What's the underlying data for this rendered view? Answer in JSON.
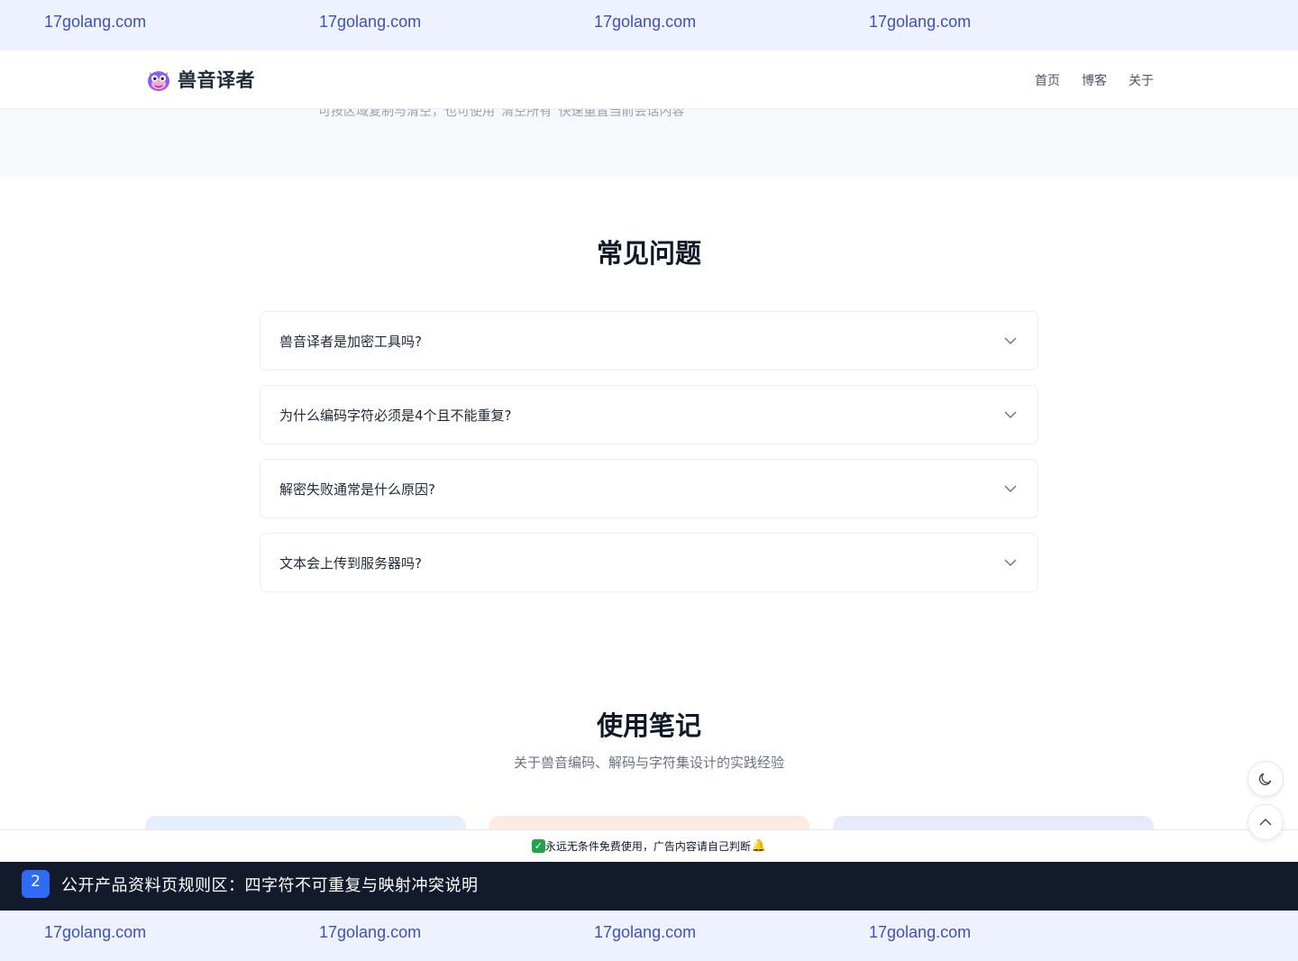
{
  "ad_banner": {
    "top_items": [
      "17golang.com",
      "17golang.com",
      "17golang.com",
      "17golang.com"
    ],
    "bottom_items": [
      "17golang.com",
      "17golang.com",
      "17golang.com",
      "17golang.com"
    ]
  },
  "header": {
    "brand": "兽音译者",
    "nav": [
      "首页",
      "博客",
      "关于"
    ]
  },
  "ghost": {
    "text": "可按区域复制与清空，也可使用“清空所有”快速重置当前会话内容"
  },
  "faq": {
    "title": "常见问题",
    "items": [
      "兽音译者是加密工具吗?",
      "为什么编码字符必须是4个且不能重复?",
      "解密失败通常是什么原因?",
      "文本会上传到服务器吗?"
    ]
  },
  "notes": {
    "title": "使用笔记",
    "subtitle": "关于兽音编码、解码与字符集设计的实践经验"
  },
  "notice": {
    "text": "永远无条件免费使用，广告内容请自己判断"
  },
  "rule_bar": {
    "badge": "2",
    "text": "公开产品资料页规则区：四字符不可重复与映射冲突说明"
  },
  "colors": {
    "accent": "#2f6bf6",
    "dark_bar": "#131a2b",
    "ad_bg": "#eef2ff",
    "ad_text": "#3f51b5"
  }
}
